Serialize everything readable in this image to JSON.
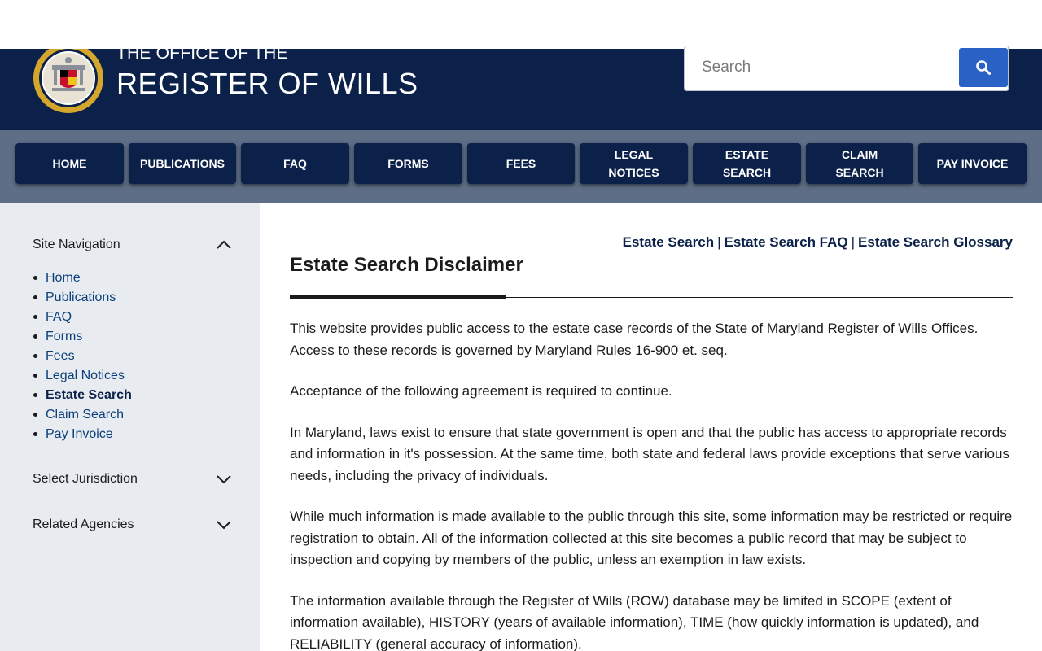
{
  "header": {
    "title_small": "THE OFFICE OF THE",
    "title_large": "REGISTER OF WILLS"
  },
  "search": {
    "placeholder": "Search",
    "value": "",
    "button_icon": "search-icon"
  },
  "nav": {
    "buttons": [
      "HOME",
      "PUBLICATIONS",
      "FAQ",
      "FORMS",
      "FEES",
      "LEGAL\nNOTICES",
      "ESTATE\nSEARCH",
      "CLAIM\nSEARCH",
      "PAY INVOICE"
    ]
  },
  "sidebar": {
    "site_nav_label": "Site Navigation",
    "site_nav_icon": "chevron-up-icon",
    "items": [
      {
        "label": "Home",
        "active": false
      },
      {
        "label": "Publications",
        "active": false
      },
      {
        "label": "FAQ",
        "active": false
      },
      {
        "label": "Forms",
        "active": false
      },
      {
        "label": "Fees",
        "active": false
      },
      {
        "label": "Legal Notices",
        "active": false
      },
      {
        "label": "Estate Search",
        "active": true
      },
      {
        "label": "Claim Search",
        "active": false
      },
      {
        "label": "Pay Invoice",
        "active": false
      }
    ],
    "jurisdiction_label": "Select Jurisdiction",
    "agencies_label": "Related Agencies",
    "collapsed_icon": "chevron-down-icon"
  },
  "main": {
    "links": [
      "Estate Search",
      "Estate Search FAQ",
      "Estate Search Glossary"
    ],
    "link_separator": "|",
    "title": "Estate Search Disclaimer",
    "paragraphs": [
      "This website provides public access to the estate case records of the State of Maryland Register of Wills Offices. Access to these records is governed by Maryland Rules 16-900 et. seq.",
      "Acceptance of the following agreement is required to continue.",
      "In Maryland, laws exist to ensure that state government is open and that the public has access to appropriate records and information in it's possession. At the same time, both state and federal laws provide exceptions that serve various needs, including the privacy of individuals.",
      "While much information is made available to the public through this site, some information may be restricted or require registration to obtain. All of the information collected at this site becomes a public record that may be subject to inspection and copying by members of the public, unless an exemption in law exists.",
      "The information available through the Register of Wills (ROW) database may be limited in SCOPE (extent of information available), HISTORY (years of available information), TIME (how quickly information is updated), and RELIABILITY (general accuracy of information)."
    ]
  },
  "colors": {
    "navy": "#0b2149",
    "nav_band": "#5d6e86",
    "search_button": "#2a61c4",
    "sidebar_bg": "#e8ecf1",
    "seal_gold": "#d4a72c"
  }
}
